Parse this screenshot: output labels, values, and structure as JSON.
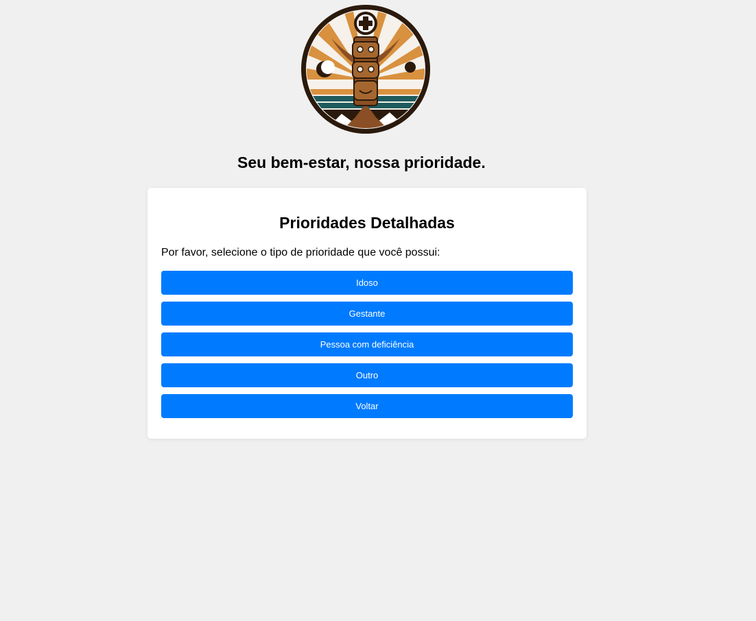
{
  "header": {
    "tagline": "Seu bem-estar, nossa prioridade."
  },
  "logo": {
    "icon": "totem-medical-logo-icon",
    "colors": {
      "ring": "#2b1a0c",
      "sun": "#d8913f",
      "sea": "#1f5b5d",
      "wood": "#8a4f24",
      "cross_bg": "#2b1a0c",
      "cross": "#ffffff"
    }
  },
  "card": {
    "title": "Prioridades Detalhadas",
    "description": "Por favor, selecione o tipo de prioridade que você possui:",
    "buttons": [
      {
        "label": "Idoso"
      },
      {
        "label": "Gestante"
      },
      {
        "label": "Pessoa com deficiência"
      },
      {
        "label": "Outro"
      },
      {
        "label": "Voltar"
      }
    ]
  },
  "colors": {
    "background": "#f0f0f0",
    "button": "#007bff",
    "button_text": "#ffffff",
    "card": "#ffffff"
  }
}
